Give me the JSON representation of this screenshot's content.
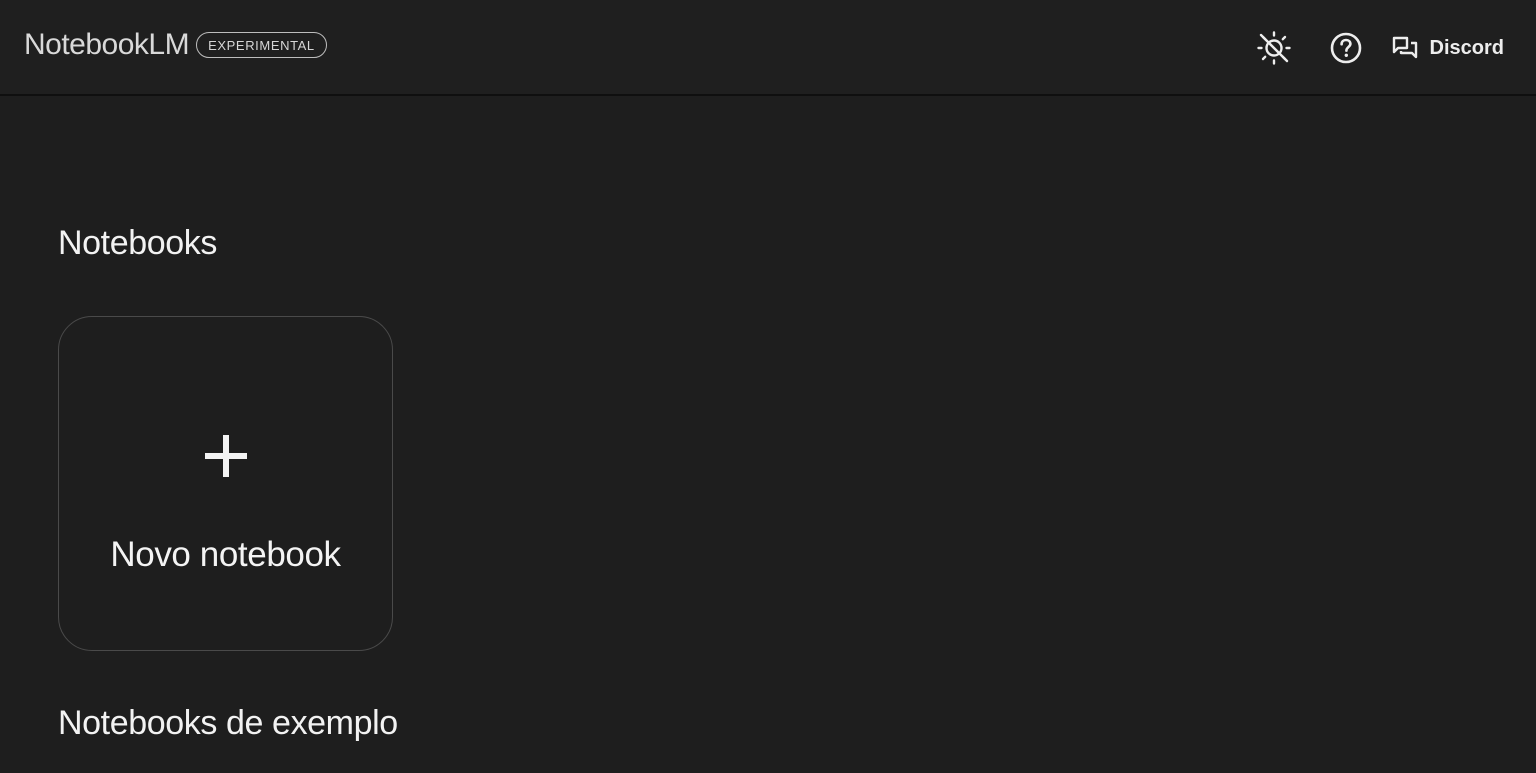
{
  "header": {
    "brand_name": "NotebookLM",
    "brand_badge": "EXPERIMENTAL",
    "actions": {
      "theme_icon": "brightness-toggle-icon",
      "help_icon": "help-circle-icon",
      "discord_icon": "forum-icon",
      "discord_label": "Discord"
    }
  },
  "main": {
    "notebooks_title": "Notebooks",
    "new_notebook": {
      "icon": "plus-icon",
      "label": "Novo notebook"
    },
    "examples_title": "Notebooks de exemplo"
  },
  "colors": {
    "background": "#1e1e1e",
    "text": "#f2f2f2",
    "card_border": "#4a4a4a"
  }
}
